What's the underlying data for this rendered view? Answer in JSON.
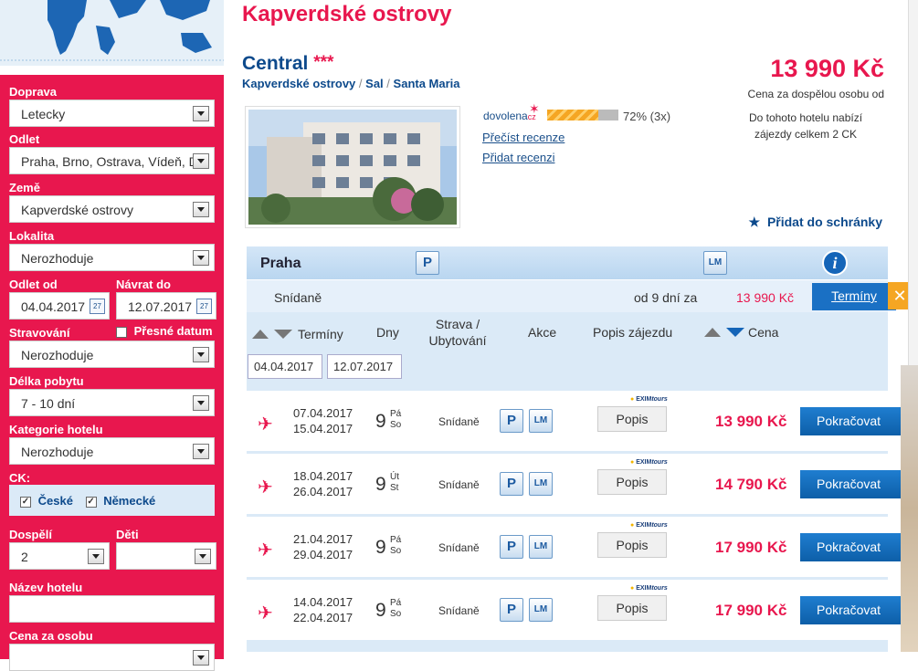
{
  "sidebar": {
    "doprava": {
      "label": "Doprava",
      "value": "Letecky"
    },
    "odlet": {
      "label": "Odlet",
      "value": "Praha, Brno, Ostrava, Vídeň, Dr"
    },
    "zeme": {
      "label": "Země",
      "value": "Kapverdské ostrovy"
    },
    "lokalita": {
      "label": "Lokalita",
      "value": "Nerozhoduje"
    },
    "odlet_od": {
      "label": "Odlet od",
      "value": "04.04.2017"
    },
    "navrat_do": {
      "label": "Návrat do",
      "value": "12.07.2017"
    },
    "stravovani": {
      "label": "Stravování",
      "value": "Nerozhoduje"
    },
    "presne_datum": {
      "label": "Přesné datum"
    },
    "delka_pobytu": {
      "label": "Délka pobytu",
      "value": "7 - 10 dní"
    },
    "kategorie_hotelu": {
      "label": "Kategorie hotelu",
      "value": "Nerozhoduje"
    },
    "ck": {
      "label": "CK:",
      "options": [
        "České",
        "Německé"
      ]
    },
    "dospeli": {
      "label": "Dospělí",
      "value": "2"
    },
    "deti": {
      "label": "Děti",
      "value": ""
    },
    "nazev_hotelu": {
      "label": "Název hotelu",
      "value": ""
    },
    "cena_za_osobu": {
      "label": "Cena za osobu"
    },
    "calendar_glyph": "27"
  },
  "main": {
    "heading": "Kapverdské ostrovy",
    "hotel_name": "Central",
    "stars": "***",
    "breadcrumb": [
      "Kapverdské ostrovy",
      "Sal",
      "Santa Maria"
    ],
    "breadcrumb_sep": "/",
    "price": "13 990 Kč",
    "price_note": "Cena za dospělou osobu od",
    "offer_note_1": "Do tohoto hotelu nabízí",
    "offer_note_2": "zájezdy celkem 2 CK",
    "rating_brand": "dovolena",
    "rating_brand_suffix": "cz",
    "rating": "72% (3x)",
    "rating_fraction": 0.72,
    "read_reviews": "Přečíst recenze",
    "add_review": "Přidat recenzi",
    "add_to_box": "Přidat do schránky"
  },
  "results": {
    "city": "Praha",
    "badge_p": "P",
    "badge_lm": "LM",
    "info_glyph": "i",
    "meal": "Snídaně",
    "from_days": "od 9 dní za",
    "from_price": "13 990 Kč",
    "terminy_button": "Termíny",
    "close_glyph": "✕",
    "headers": {
      "terminy": "Termíny",
      "dny": "Dny",
      "strava_1": "Strava /",
      "strava_2": "Ubytování",
      "akce": "Akce",
      "popis": "Popis zájezdu",
      "cena": "Cena"
    },
    "date_from": "04.04.2017",
    "date_to": "12.07.2017",
    "exim_logo": "EXIM",
    "exim_logo_suffix": "tours",
    "popis_label": "Popis",
    "continue_label": "Pokračovat",
    "rows": [
      {
        "d1": "07.04.2017",
        "d2": "15.04.2017",
        "days": "9",
        "day1": "Pá",
        "day2": "So",
        "meal": "Snídaně",
        "price": "13 990 Kč"
      },
      {
        "d1": "18.04.2017",
        "d2": "26.04.2017",
        "days": "9",
        "day1": "Út",
        "day2": "St",
        "meal": "Snídaně",
        "price": "14 790 Kč"
      },
      {
        "d1": "21.04.2017",
        "d2": "29.04.2017",
        "days": "9",
        "day1": "Pá",
        "day2": "So",
        "meal": "Snídaně",
        "price": "17 990 Kč"
      },
      {
        "d1": "14.04.2017",
        "d2": "22.04.2017",
        "days": "9",
        "day1": "Pá",
        "day2": "So",
        "meal": "Snídaně",
        "price": "17 990 Kč"
      }
    ]
  },
  "colors": {
    "accent": "#e8174e",
    "brand_blue": "#0d4a8c",
    "button_blue": "#1776c8",
    "panel_blue": "#dbeaf7"
  }
}
